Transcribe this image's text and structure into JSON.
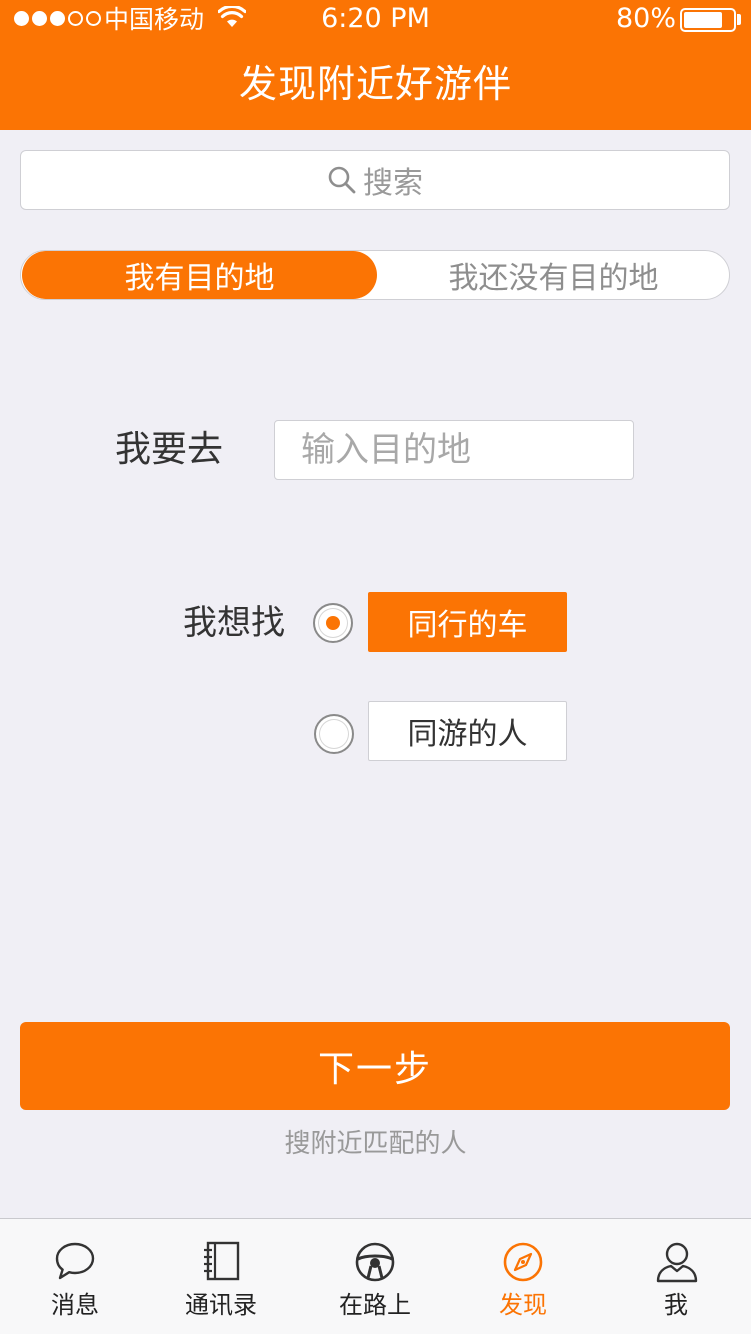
{
  "status_bar": {
    "carrier": "中国移动",
    "time": "6:20 PM",
    "battery_percent": "80%",
    "battery_level": 0.8,
    "signal_bars_filled": 3,
    "signal_bars_total": 5
  },
  "nav": {
    "title": "发现附近好游伴"
  },
  "search": {
    "placeholder": "搜索"
  },
  "segment": {
    "options": [
      "我有目的地",
      "我还没有目的地"
    ],
    "selected_index": 0
  },
  "destination": {
    "label": "我要去",
    "placeholder": "输入目的地",
    "value": ""
  },
  "find": {
    "label": "我想找",
    "options": [
      {
        "label": "同行的车",
        "selected": true
      },
      {
        "label": "同游的人",
        "selected": false
      }
    ]
  },
  "next_button": {
    "label": "下一步"
  },
  "hint": "搜附近匹配的人",
  "tabbar": {
    "items": [
      {
        "label": "消息",
        "icon": "chat-bubble-icon"
      },
      {
        "label": "通讯录",
        "icon": "contacts-book-icon"
      },
      {
        "label": "在路上",
        "icon": "steering-wheel-icon"
      },
      {
        "label": "发现",
        "icon": "compass-icon"
      },
      {
        "label": "我",
        "icon": "user-icon"
      }
    ],
    "active_index": 3
  },
  "colors": {
    "accent": "#fb7404",
    "background": "#f0eff5",
    "text": "#333333",
    "muted": "#999999"
  }
}
